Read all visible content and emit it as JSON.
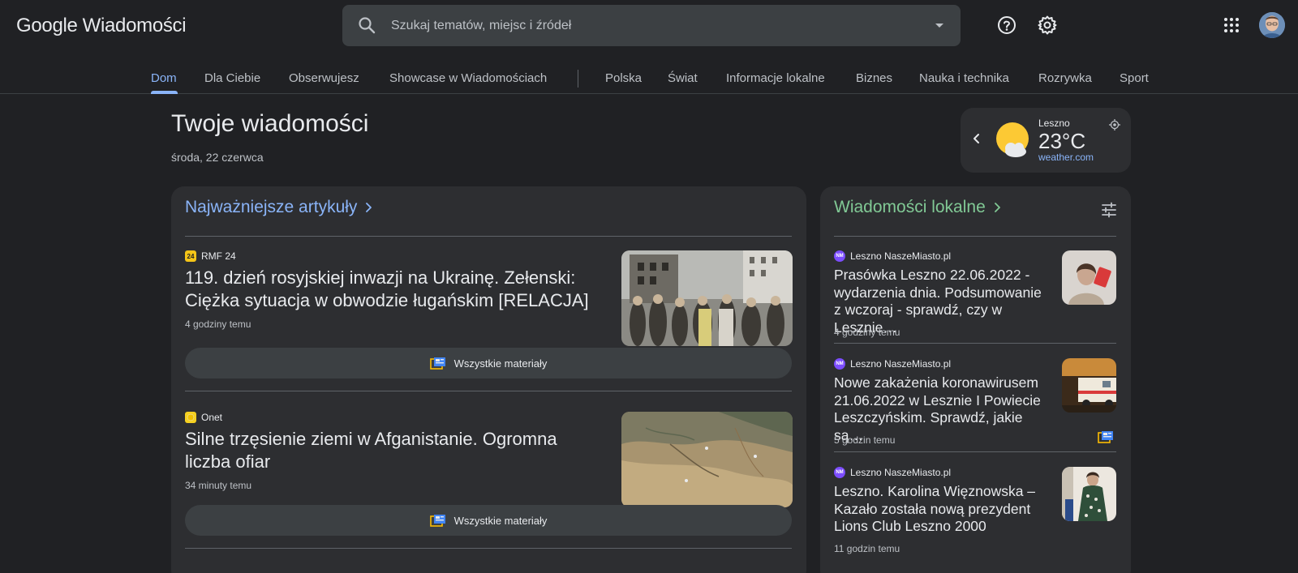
{
  "header": {
    "brand_google": "Google",
    "brand_news": "Wiadomości",
    "search_placeholder": "Szukaj tematów, miejsc i źródeł"
  },
  "nav": {
    "tabs": [
      {
        "label": "Dom",
        "active": true
      },
      {
        "label": "Dla Ciebie"
      },
      {
        "label": "Obserwujesz"
      },
      {
        "label": "Showcase w Wiadomościach"
      },
      {
        "label": "Polska"
      },
      {
        "label": "Świat"
      },
      {
        "label": "Informacje lokalne"
      },
      {
        "label": "Biznes"
      },
      {
        "label": "Nauka i technika"
      },
      {
        "label": "Rozrywka"
      },
      {
        "label": "Sport"
      }
    ]
  },
  "page": {
    "title": "Twoje wiadomości",
    "date": "środa, 22 czerwca"
  },
  "weather": {
    "location": "Leszno",
    "temperature": "23°C",
    "source": "weather.com",
    "icon": "partly-sunny-icon"
  },
  "top_stories": {
    "title": "Najważniejsze artykuły",
    "articles": [
      {
        "source": "RMF 24",
        "headline": "119. dzień rosyjskiej inwazji na Ukrainę. Zełenski: Ciężka sytuacja w obwodzie ługańskim [RELACJA]",
        "time": "4 godziny temu",
        "button": "Wszystkie materiały"
      },
      {
        "source": "Onet",
        "headline": "Silne trzęsienie ziemi w Afganistanie. Ogromna liczba ofiar",
        "time": "34 minuty temu",
        "button": "Wszystkie materiały"
      }
    ]
  },
  "local_news": {
    "title": "Wiadomości lokalne",
    "articles": [
      {
        "source": "Leszno NaszeMiasto.pl",
        "headline": "Prasówka Leszno 22.06.2022 - wydarzenia dnia. Podsumowanie z wczoraj - sprawdź, czy w Lesznie…",
        "time": "4 godziny temu"
      },
      {
        "source": "Leszno NaszeMiasto.pl",
        "headline": "Nowe zakażenia koronawirusem 21.06.2022 w Lesznie I Powiecie Leszczyńskim. Sprawdź, jakie są…",
        "time": "5 godzin temu"
      },
      {
        "source": "Leszno NaszeMiasto.pl",
        "headline": "Leszno. Karolina Więznowska – Kazało została nową prezydent Lions Club Leszno 2000",
        "time": "11 godzin temu"
      }
    ]
  },
  "colors": {
    "background": "#202124",
    "card": "#2d2e31",
    "accent_blue": "#8ab4f8",
    "accent_green": "#81c995"
  }
}
